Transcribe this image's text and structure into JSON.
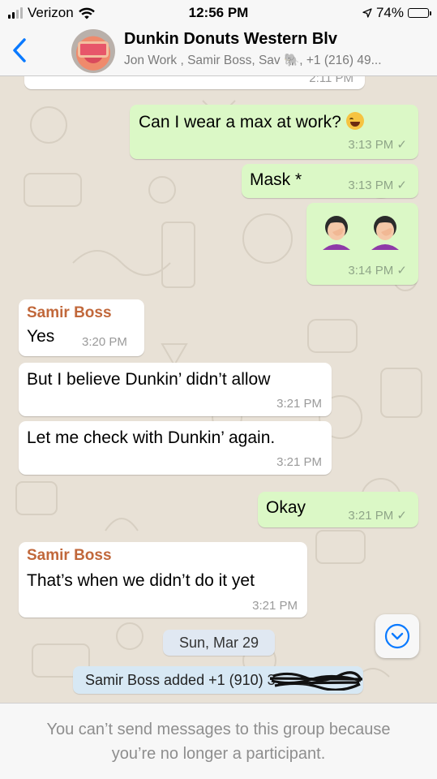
{
  "status_bar": {
    "carrier": "Verizon",
    "time": "12:56 PM",
    "battery": "74%",
    "battery_level": 0.74
  },
  "header": {
    "title": "Dunkin Donuts Western Blv",
    "subtitle": "Jon Work , Samir Boss, Sav 🐘, +1 (216) 49..."
  },
  "messages": {
    "prev_time": "2:11 PM",
    "m1": {
      "text": "Can I wear a max at work?",
      "emoji_name": "rolling-on-floor-laughing-emoji",
      "time": "3:13 PM"
    },
    "m2": {
      "text": "Mask *",
      "time": "3:13 PM"
    },
    "m3": {
      "emoji_name": "woman-facepalming-emoji",
      "time": "3:14 PM"
    },
    "m4": {
      "sender": "Samir Boss",
      "text": "Yes",
      "time": "3:20 PM"
    },
    "m5": {
      "text": "But I believe Dunkin’ didn’t allow",
      "time": "3:21 PM"
    },
    "m6": {
      "text": "Let me check with Dunkin’ again.",
      "time": "3:21 PM"
    },
    "m7": {
      "text": "Okay",
      "time": "3:21 PM"
    },
    "m8": {
      "sender": "Samir Boss",
      "text": "That’s when we didn’t do it yet",
      "time": "3:21 PM"
    }
  },
  "date_separator": "Sun, Mar 29",
  "system_message": "Samir Boss added +1 (910) 3",
  "read_check": "✓",
  "footer": {
    "line1": "You can’t send messages to this group because",
    "line2": "you’re no longer a participant."
  },
  "colors": {
    "outgoing_bubble": "#dbf8c6",
    "incoming_bubble": "#ffffff",
    "sender_name": "#c1683b",
    "accent_blue": "#0a7aff"
  }
}
